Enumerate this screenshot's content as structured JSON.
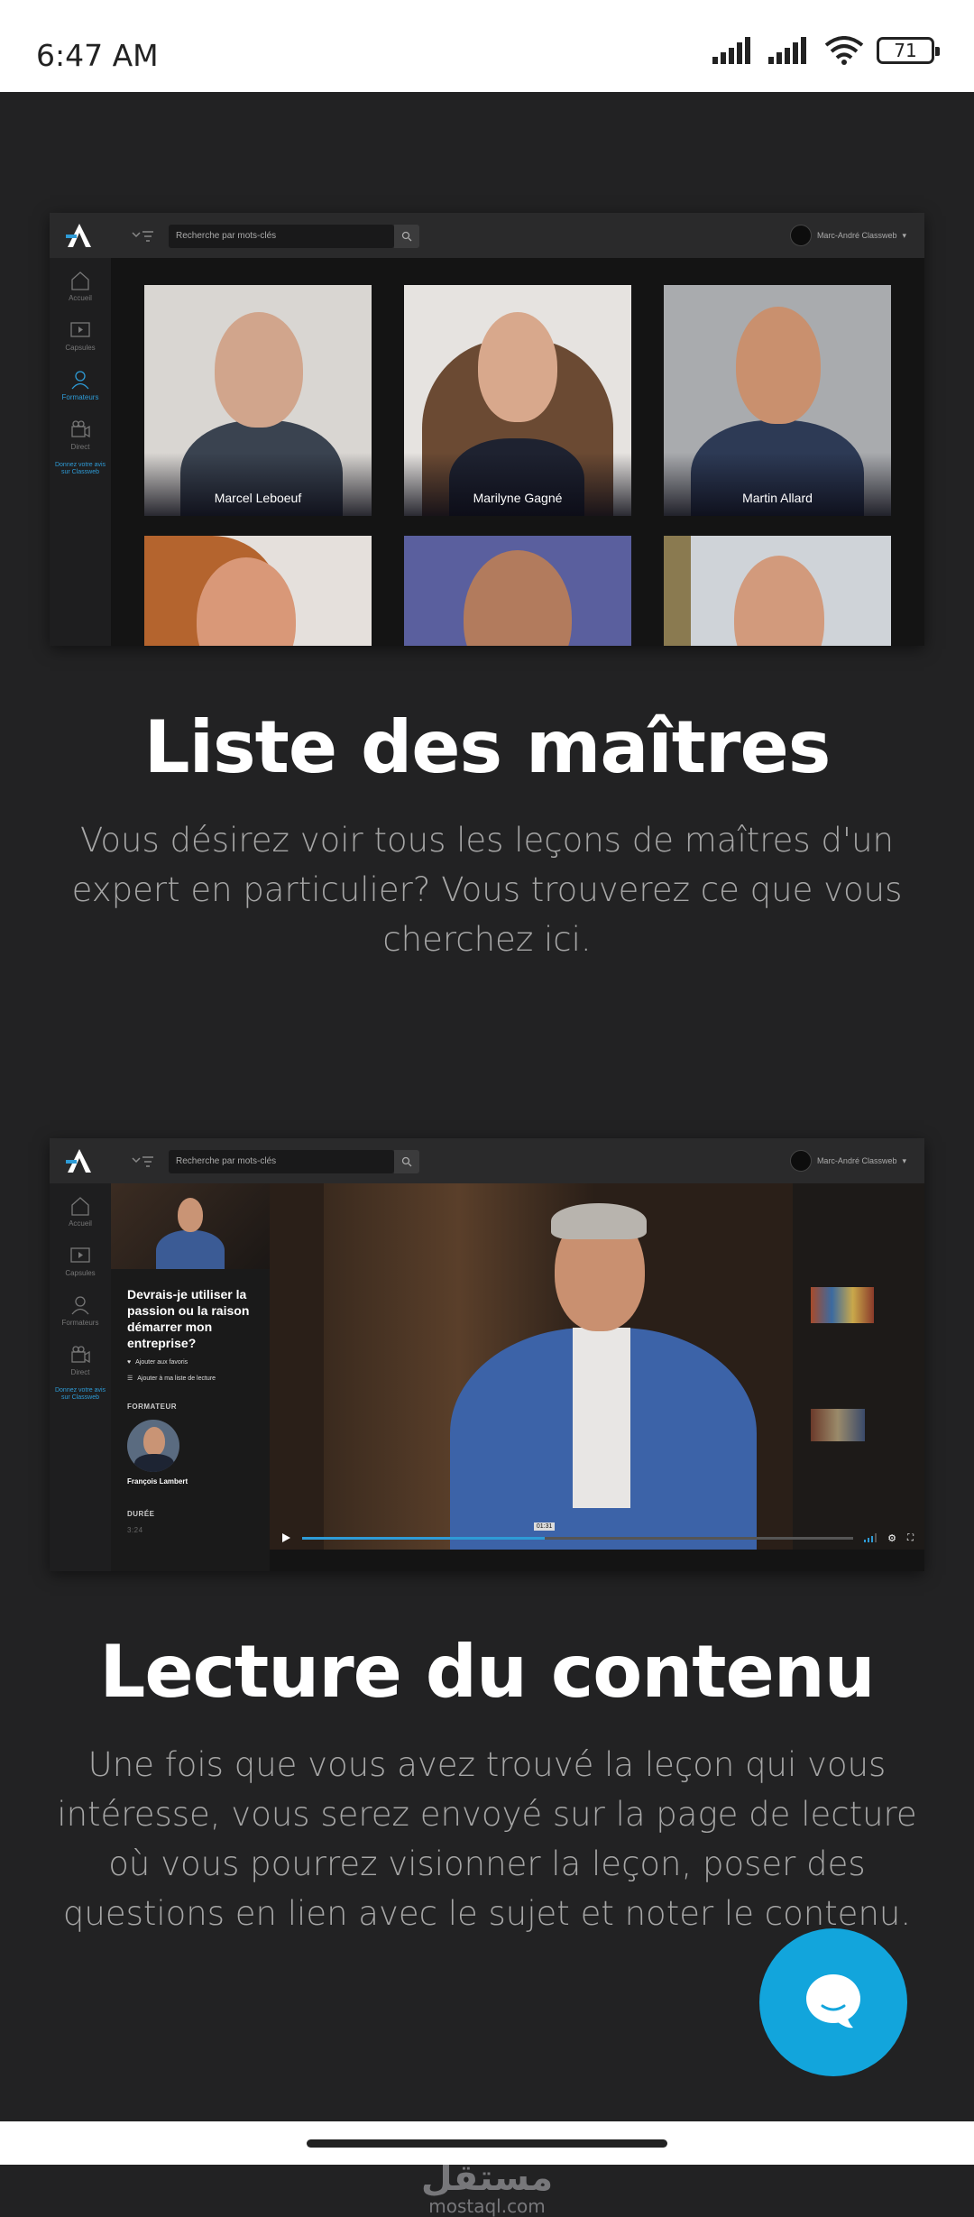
{
  "status_bar": {
    "time": "6:47 AM",
    "battery": "71",
    "icons": [
      "signal-icon",
      "signal-icon",
      "wifi-icon",
      "battery-icon"
    ]
  },
  "app": {
    "search_placeholder": "Recherche par mots-clés",
    "user_name": "Marc-André Classweb",
    "sidebar": [
      {
        "label": "Accueil",
        "icon": "home-icon"
      },
      {
        "label": "Capsules",
        "icon": "play-icon"
      },
      {
        "label": "Formateurs",
        "icon": "user-icon"
      },
      {
        "label": "Direct",
        "icon": "camera-icon"
      }
    ],
    "sidebar_cta": "Donnez votre avis sur Classweb"
  },
  "masters": {
    "people": [
      {
        "name": "Marcel Leboeuf"
      },
      {
        "name": "Marilyne Gagné"
      },
      {
        "name": "Martin Allard"
      },
      {
        "name": ""
      },
      {
        "name": ""
      },
      {
        "name": ""
      }
    ],
    "title": "Liste des maîtres",
    "description": "Vous désirez voir tous les leçons de maîtres d'un expert en particulier? Vous trouverez ce que vous cherchez ici."
  },
  "player": {
    "lesson_title": "Devrais-je utiliser la passion ou la raison démarrer mon entreprise?",
    "add_favorite": "Ajouter aux favoris",
    "add_list": "Ajouter à ma liste de lecture",
    "trainer_label": "FORMATEUR",
    "trainer_name": "François Lambert",
    "duration_label": "DURÉE",
    "duration_value": "3:24",
    "current_time": "01:31",
    "progress": 0.44,
    "title": "Lecture du contenu",
    "description": "Une fois que vous avez trouvé la leçon qui vous intéresse, vous serez envoyé sur la page de lecture où vous pourrez visionner la leçon, poser des questions en lien avec le sujet et noter le contenu."
  },
  "watermark": {
    "arabic": "مستقل",
    "latin": "mostaql.com"
  },
  "colors": {
    "accent": "#2e9bd6",
    "chat": "#12a5dc",
    "background": "#222223"
  }
}
